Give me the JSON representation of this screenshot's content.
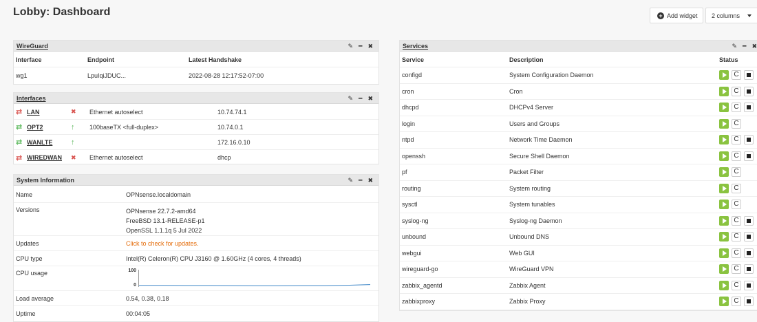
{
  "page": {
    "title": "Lobby: Dashboard"
  },
  "toolbar": {
    "add_widget_label": "Add widget",
    "columns_value": "2 columns"
  },
  "icons": {
    "edit": "✎",
    "minimize": "━",
    "close": "✖",
    "restart": "C",
    "up": "↑",
    "down": "✖",
    "link": "⇄"
  },
  "wireguard": {
    "title": "WireGuard",
    "headers": {
      "interface": "Interface",
      "endpoint": "Endpoint",
      "handshake": "Latest Handshake"
    },
    "rows": [
      {
        "interface": "wg1",
        "endpoint": "LpuIqiJDUC...",
        "handshake": "2022-08-28 12:17:52-07:00"
      }
    ]
  },
  "interfaces": {
    "title": "Interfaces",
    "rows": [
      {
        "name": "LAN",
        "status": "down",
        "media": "Ethernet autoselect",
        "address": "10.74.74.1"
      },
      {
        "name": "OPT2",
        "status": "up",
        "media": "100baseTX <full-duplex>",
        "address": "10.74.0.1"
      },
      {
        "name": "WANLTE",
        "status": "up",
        "media": "",
        "address": "172.16.0.10"
      },
      {
        "name": "WIREDWAN",
        "status": "down",
        "media": "Ethernet autoselect",
        "address": "dhcp"
      }
    ]
  },
  "sysinfo": {
    "title": "System Information",
    "labels": {
      "name": "Name",
      "versions": "Versions",
      "updates": "Updates",
      "cpu_type": "CPU type",
      "cpu_usage": "CPU usage",
      "load": "Load average",
      "uptime": "Uptime"
    },
    "name": "OPNsense.localdomain",
    "versions": [
      "OPNsense 22.7.2-amd64",
      "FreeBSD 13.1-RELEASE-p1",
      "OpenSSL 1.1.1q 5 Jul 2022"
    ],
    "updates": "Click to check for updates.",
    "cpu_type": "Intel(R) Celeron(R) CPU J3160 @ 1.60GHz (4 cores, 4 threads)",
    "cpu_axis": {
      "max": "100",
      "min": "0"
    },
    "cpu_series": [
      5,
      5,
      4,
      4,
      3,
      2,
      2,
      3,
      3,
      6,
      10
    ],
    "load": "0.54, 0.38, 0.18",
    "uptime": "00:04:05"
  },
  "services": {
    "title": "Services",
    "headers": {
      "service": "Service",
      "description": "Description",
      "status": "Status"
    },
    "rows": [
      {
        "service": "configd",
        "description": "System Configuration Daemon",
        "stop": true
      },
      {
        "service": "cron",
        "description": "Cron",
        "stop": true
      },
      {
        "service": "dhcpd",
        "description": "DHCPv4 Server",
        "stop": true
      },
      {
        "service": "login",
        "description": "Users and Groups",
        "stop": false
      },
      {
        "service": "ntpd",
        "description": "Network Time Daemon",
        "stop": true
      },
      {
        "service": "openssh",
        "description": "Secure Shell Daemon",
        "stop": true
      },
      {
        "service": "pf",
        "description": "Packet Filter",
        "stop": false
      },
      {
        "service": "routing",
        "description": "System routing",
        "stop": false
      },
      {
        "service": "sysctl",
        "description": "System tunables",
        "stop": false
      },
      {
        "service": "syslog-ng",
        "description": "Syslog-ng Daemon",
        "stop": true
      },
      {
        "service": "unbound",
        "description": "Unbound DNS",
        "stop": true
      },
      {
        "service": "webgui",
        "description": "Web GUI",
        "stop": true
      },
      {
        "service": "wireguard-go",
        "description": "WireGuard VPN",
        "stop": true
      },
      {
        "service": "zabbix_agentd",
        "description": "Zabbix Agent",
        "stop": true
      },
      {
        "service": "zabbixproxy",
        "description": "Zabbix Proxy",
        "stop": true
      }
    ]
  }
}
